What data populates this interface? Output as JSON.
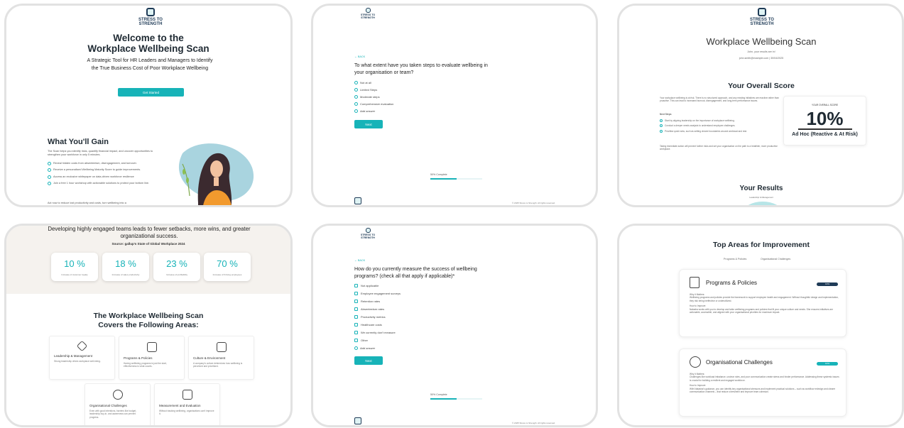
{
  "brand": {
    "line1": "STRESS TO",
    "line2": "STRENGTH"
  },
  "panel1": {
    "title1": "Welcome to the",
    "title2": "Workplace Wellbeing Scan",
    "subtitle": "A Strategic Tool for HR Leaders and Managers to Identify the True Business Cost of Poor Workplace Wellbeing",
    "cta": "Get Started",
    "gain_title": "What You'll Gain",
    "gain_intro": "The Scan helps you identify risks, quantify financial impact, and uncover opportunities to strengthen your workforce in only 5 minutes.",
    "bullets": [
      "Reveal hidden costs from absenteeism, disengagement, and turnover.",
      "Receive a personalised Wellbeing Maturity Score to guide improvements.",
      "Access an exclusive whitepaper on data-driven workforce resilience",
      "Join a free 1 hour workshop with actionable solutions to protect your bottom line."
    ],
    "footer_text": "Act now to reduce lost productivity and costs, turn wellbeing into a"
  },
  "panel2": {
    "back": "← BACK",
    "question": "To what extent have you taken steps to evaluate wellbeing in your organisation or team?",
    "options": [
      "Not at all",
      "Limited Steps",
      "Moderate steps",
      "Comprehensive evaluation"
    ],
    "add_answer": "Add answer",
    "next": "Next",
    "progress_label": "50% Complete",
    "progress_pct": 50,
    "copyright": "© 2025 Stress to Strength. All rights reserved."
  },
  "panel3": {
    "title": "Workplace Wellbeing Scan",
    "greeting": "John, your results are in!",
    "email_line": "john.smith@example.com | 30/04/2025",
    "overall_heading": "Your Overall Score",
    "intro": "Your workplace wellbeing is at risk. There is no structured approach, and any existing initiatives are reactive rather than proactive. This can lead to increased burnout, disengagement, and long-term performance issues.",
    "next_steps": "Next Steps",
    "steps": [
      "Start by aligning leadership on the importance of workplace wellbeing.",
      "Conduct a deeper needs analysis to understand employee challenges.",
      "Prioritise quick wins, such as setting clearer boundaries around workload and rest."
    ],
    "closing": "Taking immediate action will prevent further risks and set your organisation on the path to a healthier, more productive workplace.",
    "score_label": "YOUR OVERALL SCORE",
    "score_value": "10%",
    "score_level": "Ad Hoc (Reactive & At Risk)",
    "results_heading": "Your Results",
    "results_sub": "Leadership & Management"
  },
  "panel4": {
    "headline": "Developing highly engaged teams leads to fewer setbacks, more wins, and greater organizational success.",
    "source": "Source: gallup's State of Global Workplace 2024",
    "stats": [
      {
        "value": "10 %",
        "label": "Increase of customer loyalty"
      },
      {
        "value": "18 %",
        "label": "Increase of sales productivity"
      },
      {
        "value": "23 %",
        "label": "Increase of profitability"
      },
      {
        "value": "70 %",
        "label": "Increase of thriving employees"
      }
    ],
    "section_title1": "The Workplace Wellbeing Scan",
    "section_title2": "Covers the Following Areas:",
    "areas": [
      {
        "title": "Leadership & Management",
        "desc": "Strong leadership drives workplace well-being."
      },
      {
        "title": "Programs & Policies",
        "desc": "Having wellbeing programs is just the start, effectiveness is what counts."
      },
      {
        "title": "Culture & Environment",
        "desc": "A company's culture determines how wellbeing is perceived and prioritised."
      },
      {
        "title": "Organisational Challenges",
        "desc": "Even with good intentions, barriers like budget, leadership buy-in, and awareness can prevent progress."
      },
      {
        "title": "Measurement and Evaluation",
        "desc": "Without tracking wellbeing, organisations can't improve it."
      }
    ]
  },
  "panel5": {
    "back": "← BACK",
    "question": "How do you currently measure the success of wellbeing programs? (check all that apply if applicable)*",
    "options": [
      "Not applicable",
      "Employee engagement surveys",
      "Retention rates",
      "Absenteeism rates",
      "Productivity metrics",
      "Healthcare costs",
      "We currently don't measure",
      "Other"
    ],
    "add_answer": "Add answer",
    "next": "Next",
    "progress_label": "50% Complete",
    "progress_pct": 50,
    "copyright": "© 2025 Stress to Strength. All rights reserved."
  },
  "panel6": {
    "title": "Top Areas for Improvement",
    "tabs": [
      "Programs & Policies",
      "Organisational Challenges"
    ],
    "items": [
      {
        "title": "Programs & Policies",
        "badge": "13%",
        "why_label": "Why it Matters:",
        "why": "Wellbeing programs and policies provide the framework to support employee health and engagement. Without thoughtful design and implementation, they risk being ineffective or underutilized.",
        "how_label": "How to Improve:",
        "how": "Natasha works with you to develop and tailor wellbeing programs and policies that fit your unique culture and needs. She ensures initiatives are actionable, accessible, and aligned with your organisational priorities for maximum impact."
      },
      {
        "title": "Organisational Challenges",
        "badge": "10%",
        "why_label": "Why it Matters:",
        "why": "Challenges like workload imbalance, unclear roles, and poor communication create stress and hinder performance. Addressing these systemic issues is crucial for building a resilient and engaged workforce.",
        "how_label": "How to Improve:",
        "how": "With Natasha's guidance, you can identify key organisational stressors and implement practical solutions – such as workflow redesign and clearer communication channels – that reduce overwhelm and improve team cohesion."
      }
    ]
  },
  "colors": {
    "accent": "#17b3b8",
    "navy": "#1f3b57",
    "border": "#e2e2e2",
    "beige": "#f5f2ee"
  }
}
